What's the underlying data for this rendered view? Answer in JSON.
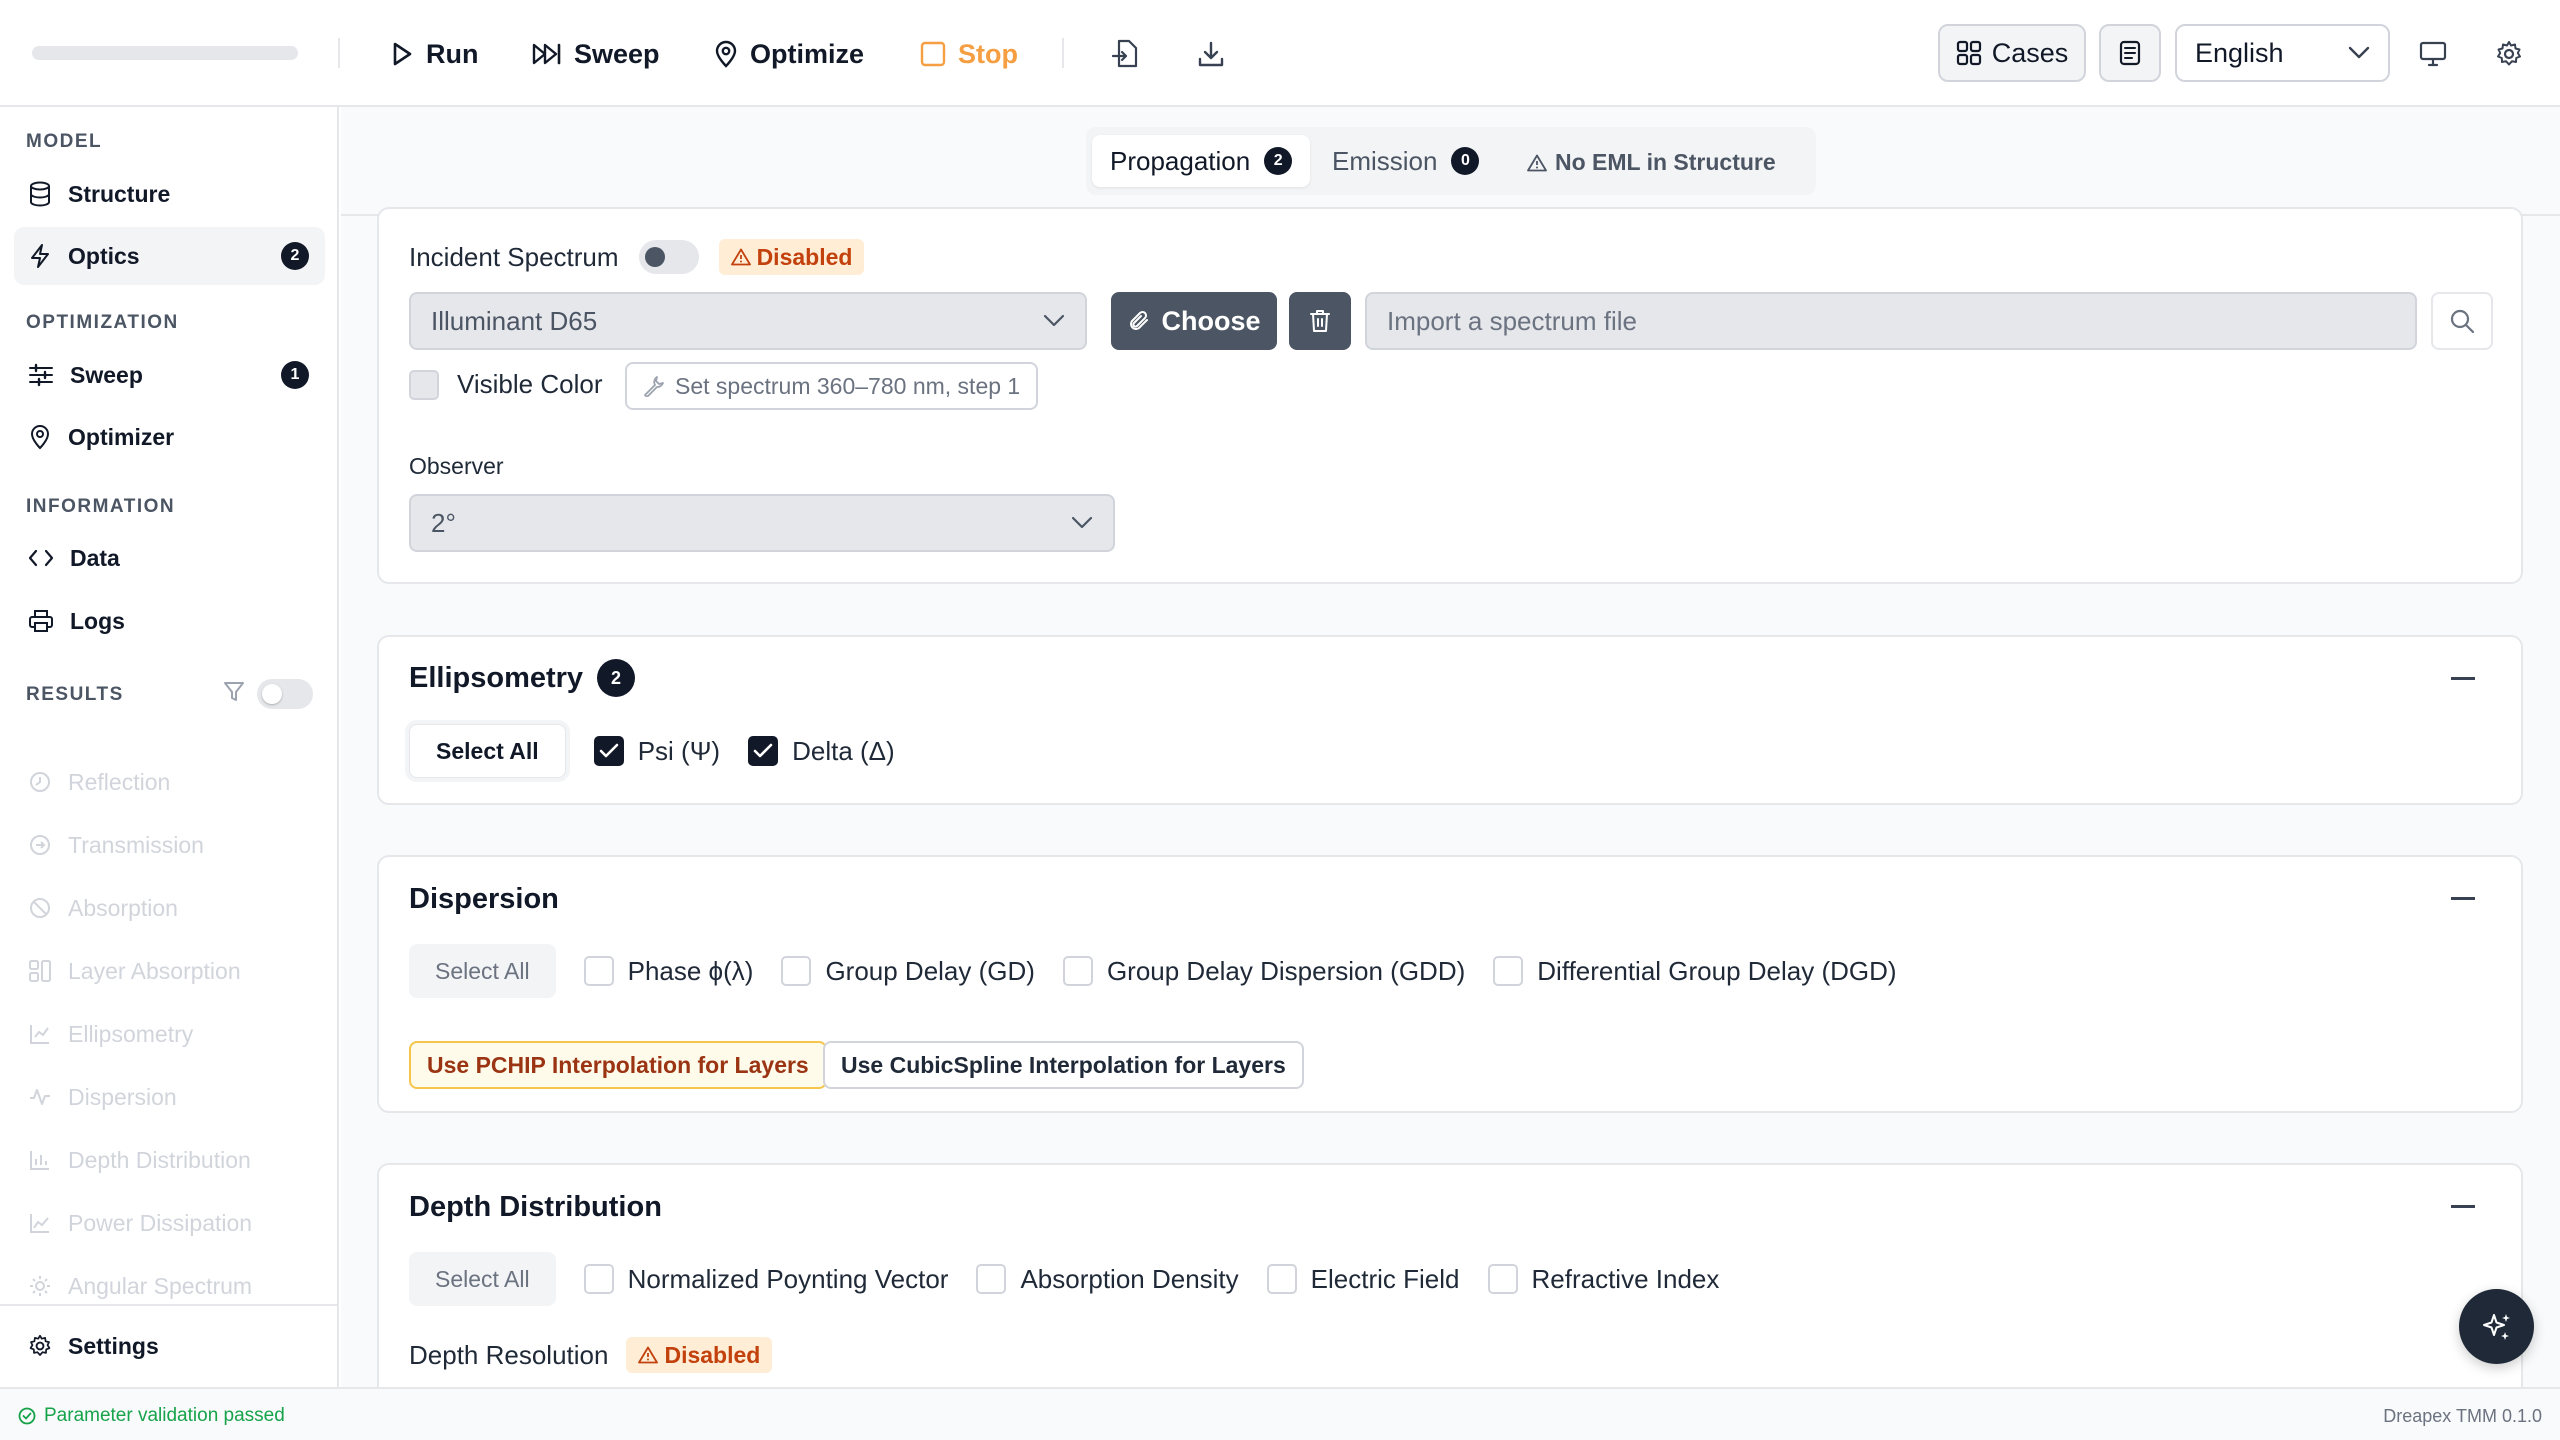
{
  "toolbar": {
    "run_label": "Run",
    "sweep_label": "Sweep",
    "optimize_label": "Optimize",
    "stop_label": "Stop",
    "cases_label": "Cases",
    "language": "English",
    "stop_color": "#f59e42"
  },
  "sidebar": {
    "model_title": "MODEL",
    "structure": "Structure",
    "optics": "Optics",
    "optics_badge": "2",
    "optimization_title": "OPTIMIZATION",
    "sweep": "Sweep",
    "sweep_badge": "1",
    "optimizer": "Optimizer",
    "information_title": "INFORMATION",
    "data": "Data",
    "logs": "Logs",
    "results_title": "RESULTS",
    "results": [
      "Reflection",
      "Transmission",
      "Absorption",
      "Layer Absorption",
      "Ellipsometry",
      "Dispersion",
      "Depth Distribution",
      "Power Dissipation",
      "Angular Spectrum"
    ],
    "settings": "Settings"
  },
  "tabs": {
    "propagation": "Propagation",
    "propagation_badge": "2",
    "emission": "Emission",
    "emission_badge": "0",
    "warning": "No EML in Structure"
  },
  "spectrum": {
    "incident_label": "Incident Spectrum",
    "disabled_label": "Disabled",
    "illuminant": "Illuminant D65",
    "choose_label": "Choose",
    "import_placeholder": "Import a spectrum file",
    "visible_color_label": "Visible Color",
    "set_spectrum_label": "Set spectrum 360–780 nm, step 1",
    "observer_label": "Observer",
    "observer_value": "2°"
  },
  "ellipsometry": {
    "title": "Ellipsometry",
    "badge": "2",
    "select_all": "Select All",
    "options": [
      "Psi (Ψ)",
      "Delta (Δ)"
    ]
  },
  "dispersion": {
    "title": "Dispersion",
    "select_all": "Select All",
    "options": [
      "Phase ϕ(λ)",
      "Group Delay (GD)",
      "Group Delay Dispersion (GDD)",
      "Differential Group Delay (DGD)"
    ],
    "pchip_label": "Use PCHIP Interpolation for Layers",
    "cubic_label": "Use CubicSpline Interpolation for Layers"
  },
  "depth": {
    "title": "Depth Distribution",
    "select_all": "Select All",
    "options": [
      "Normalized Poynting Vector",
      "Absorption Density",
      "Electric Field",
      "Refractive Index"
    ],
    "resolution_label": "Depth Resolution",
    "disabled_label": "Disabled"
  },
  "footer": {
    "status": "Parameter validation passed",
    "version": "Dreapex TMM 0.1.0"
  }
}
